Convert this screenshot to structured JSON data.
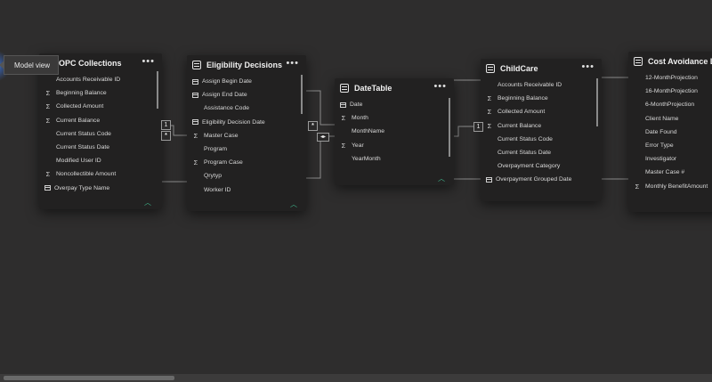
{
  "tooltip": {
    "label": "Model view"
  },
  "tables": {
    "opc": {
      "title": "OPC Collections",
      "more": "•••",
      "fields": [
        {
          "icon": "",
          "name": "Accounts Receivable ID"
        },
        {
          "icon": "Σ",
          "name": "Beginning Balance"
        },
        {
          "icon": "Σ",
          "name": "Collected Amount"
        },
        {
          "icon": "Σ",
          "name": "Current Balance"
        },
        {
          "icon": "",
          "name": "Current Status Code"
        },
        {
          "icon": "",
          "name": "Current Status Date"
        },
        {
          "icon": "",
          "name": "Modified User ID"
        },
        {
          "icon": "Σ",
          "name": "Noncollectible Amount"
        },
        {
          "icon": "cal",
          "name": "Overpay Type Name"
        }
      ]
    },
    "eligibility": {
      "title": "Eligibility Decisions",
      "more": "•••",
      "fields": [
        {
          "icon": "cal",
          "name": "Assign Begin Date"
        },
        {
          "icon": "cal",
          "name": "Assign End Date"
        },
        {
          "icon": "",
          "name": "Assistance Code"
        },
        {
          "icon": "cal",
          "name": "Eligibility Decision Date"
        },
        {
          "icon": "Σ",
          "name": "Master Case"
        },
        {
          "icon": "",
          "name": "Program"
        },
        {
          "icon": "Σ",
          "name": "Program Case"
        },
        {
          "icon": "",
          "name": "Qrytyp"
        },
        {
          "icon": "",
          "name": "Worker ID"
        }
      ]
    },
    "datetable": {
      "title": "DateTable",
      "more": "•••",
      "fields": [
        {
          "icon": "cal",
          "name": "Date"
        },
        {
          "icon": "Σ",
          "name": "Month"
        },
        {
          "icon": "",
          "name": "MonthName"
        },
        {
          "icon": "Σ",
          "name": "Year"
        },
        {
          "icon": "",
          "name": "YearMonth"
        }
      ]
    },
    "childcare": {
      "title": "ChildCare",
      "more": "•••",
      "fields": [
        {
          "icon": "",
          "name": "Accounts Receivable ID"
        },
        {
          "icon": "Σ",
          "name": "Beginning Balance"
        },
        {
          "icon": "Σ",
          "name": "Collected Amount"
        },
        {
          "icon": "Σ",
          "name": "Current Balance"
        },
        {
          "icon": "",
          "name": "Current Status Code"
        },
        {
          "icon": "",
          "name": "Current Status Date"
        },
        {
          "icon": "",
          "name": "Overpayment Category"
        },
        {
          "icon": "cal",
          "name": "Overpayment Grouped Date"
        }
      ]
    },
    "cost": {
      "title": "Cost Avoidance Log",
      "more": "",
      "fields": [
        {
          "icon": "",
          "name": "12-MonthProjection"
        },
        {
          "icon": "",
          "name": "16-MonthProjection"
        },
        {
          "icon": "",
          "name": "6-MonthProjection"
        },
        {
          "icon": "",
          "name": "Client Name"
        },
        {
          "icon": "",
          "name": "Date Found"
        },
        {
          "icon": "",
          "name": "Error Type"
        },
        {
          "icon": "",
          "name": "Investigator"
        },
        {
          "icon": "",
          "name": "Master Case #"
        },
        {
          "icon": "Σ",
          "name": "Monthly BenefitAmount"
        }
      ]
    }
  },
  "relationships": {
    "one": "1",
    "many": "*",
    "bidirectional": "◂▸"
  },
  "colors": {
    "background": "#2e2d2d",
    "card": "#222121",
    "accent": "#3fb58b"
  }
}
